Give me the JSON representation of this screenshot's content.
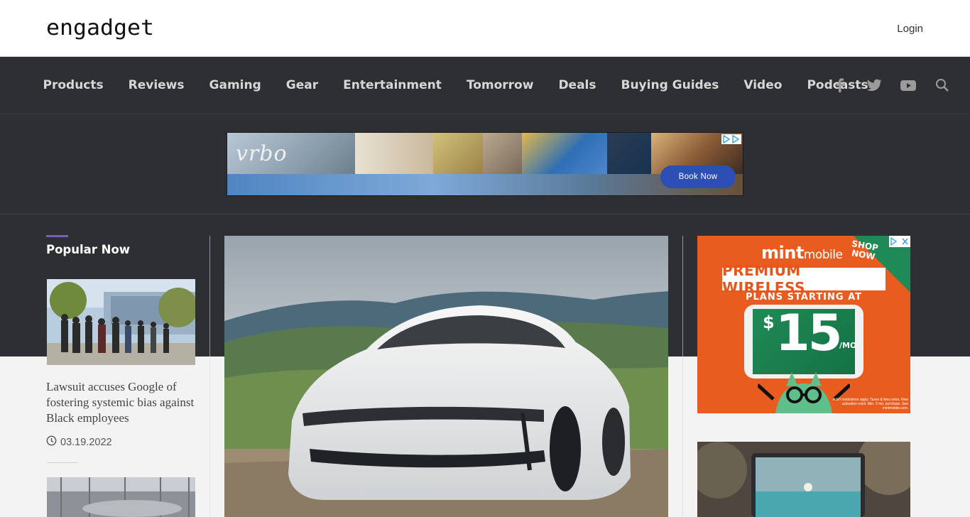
{
  "header": {
    "logo_text": "engadget",
    "login_label": "Login"
  },
  "nav": {
    "items": [
      "Products",
      "Reviews",
      "Gaming",
      "Gear",
      "Entertainment",
      "Tomorrow",
      "Deals",
      "Buying Guides",
      "Video",
      "Podcasts"
    ],
    "social_icons": [
      "facebook-icon",
      "twitter-icon",
      "youtube-icon",
      "search-icon"
    ]
  },
  "banner_ad": {
    "brand": "vrbo",
    "cta": "Book Now"
  },
  "popular": {
    "title": "Popular Now",
    "items": [
      {
        "headline": "Lawsuit accuses Google of fostering systemic bias against Black employees",
        "date": "03.19.2022"
      }
    ]
  },
  "side_ad": {
    "brand": "mint",
    "brand_suffix": "mobile",
    "headline": "PREMIUM WIRELESS",
    "sub": "PLANS STARTING AT",
    "currency": "$",
    "price": "15",
    "unit": "/MO",
    "cta_line1": "SHOP",
    "cta_line2": "NOW",
    "fine_print": "Add'l restrictions apply. Taxes & fees extra. New activation req'd. Min. 3 mo. purchase. See mintmobile.com."
  },
  "colors": {
    "nav_bg": "#2d2f33",
    "accent": "#7b5cc4",
    "mint_orange": "#e85d1f",
    "book_now": "#2d4fb5"
  }
}
